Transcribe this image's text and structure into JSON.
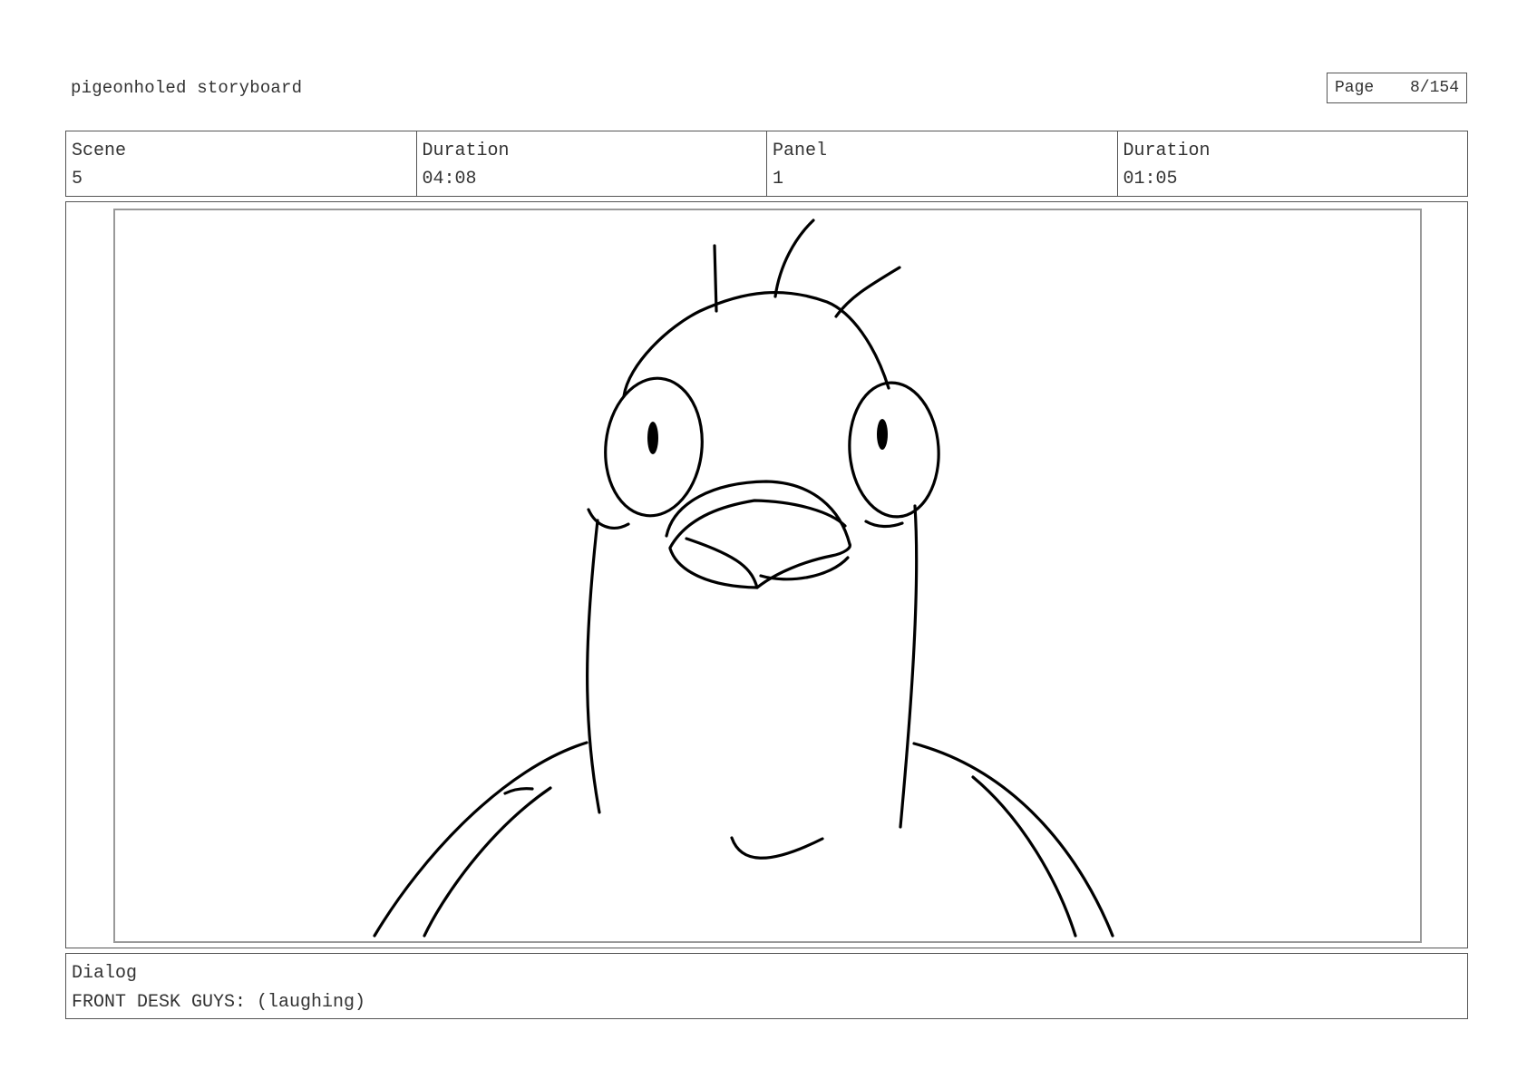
{
  "header": {
    "title": "pigeonholed storyboard",
    "page_label": "Page",
    "page_number": "8/154"
  },
  "info": {
    "scene_label": "Scene",
    "scene_value": "5",
    "scene_duration_label": "Duration",
    "scene_duration_value": "04:08",
    "panel_label": "Panel",
    "panel_value": "1",
    "panel_duration_label": "Duration",
    "panel_duration_value": "01:05"
  },
  "dialog": {
    "label": "Dialog",
    "text": "FRONT DESK GUYS: (laughing)"
  },
  "colors": {
    "line": "#000000",
    "border": "#555555",
    "inner_border": "#999999"
  }
}
